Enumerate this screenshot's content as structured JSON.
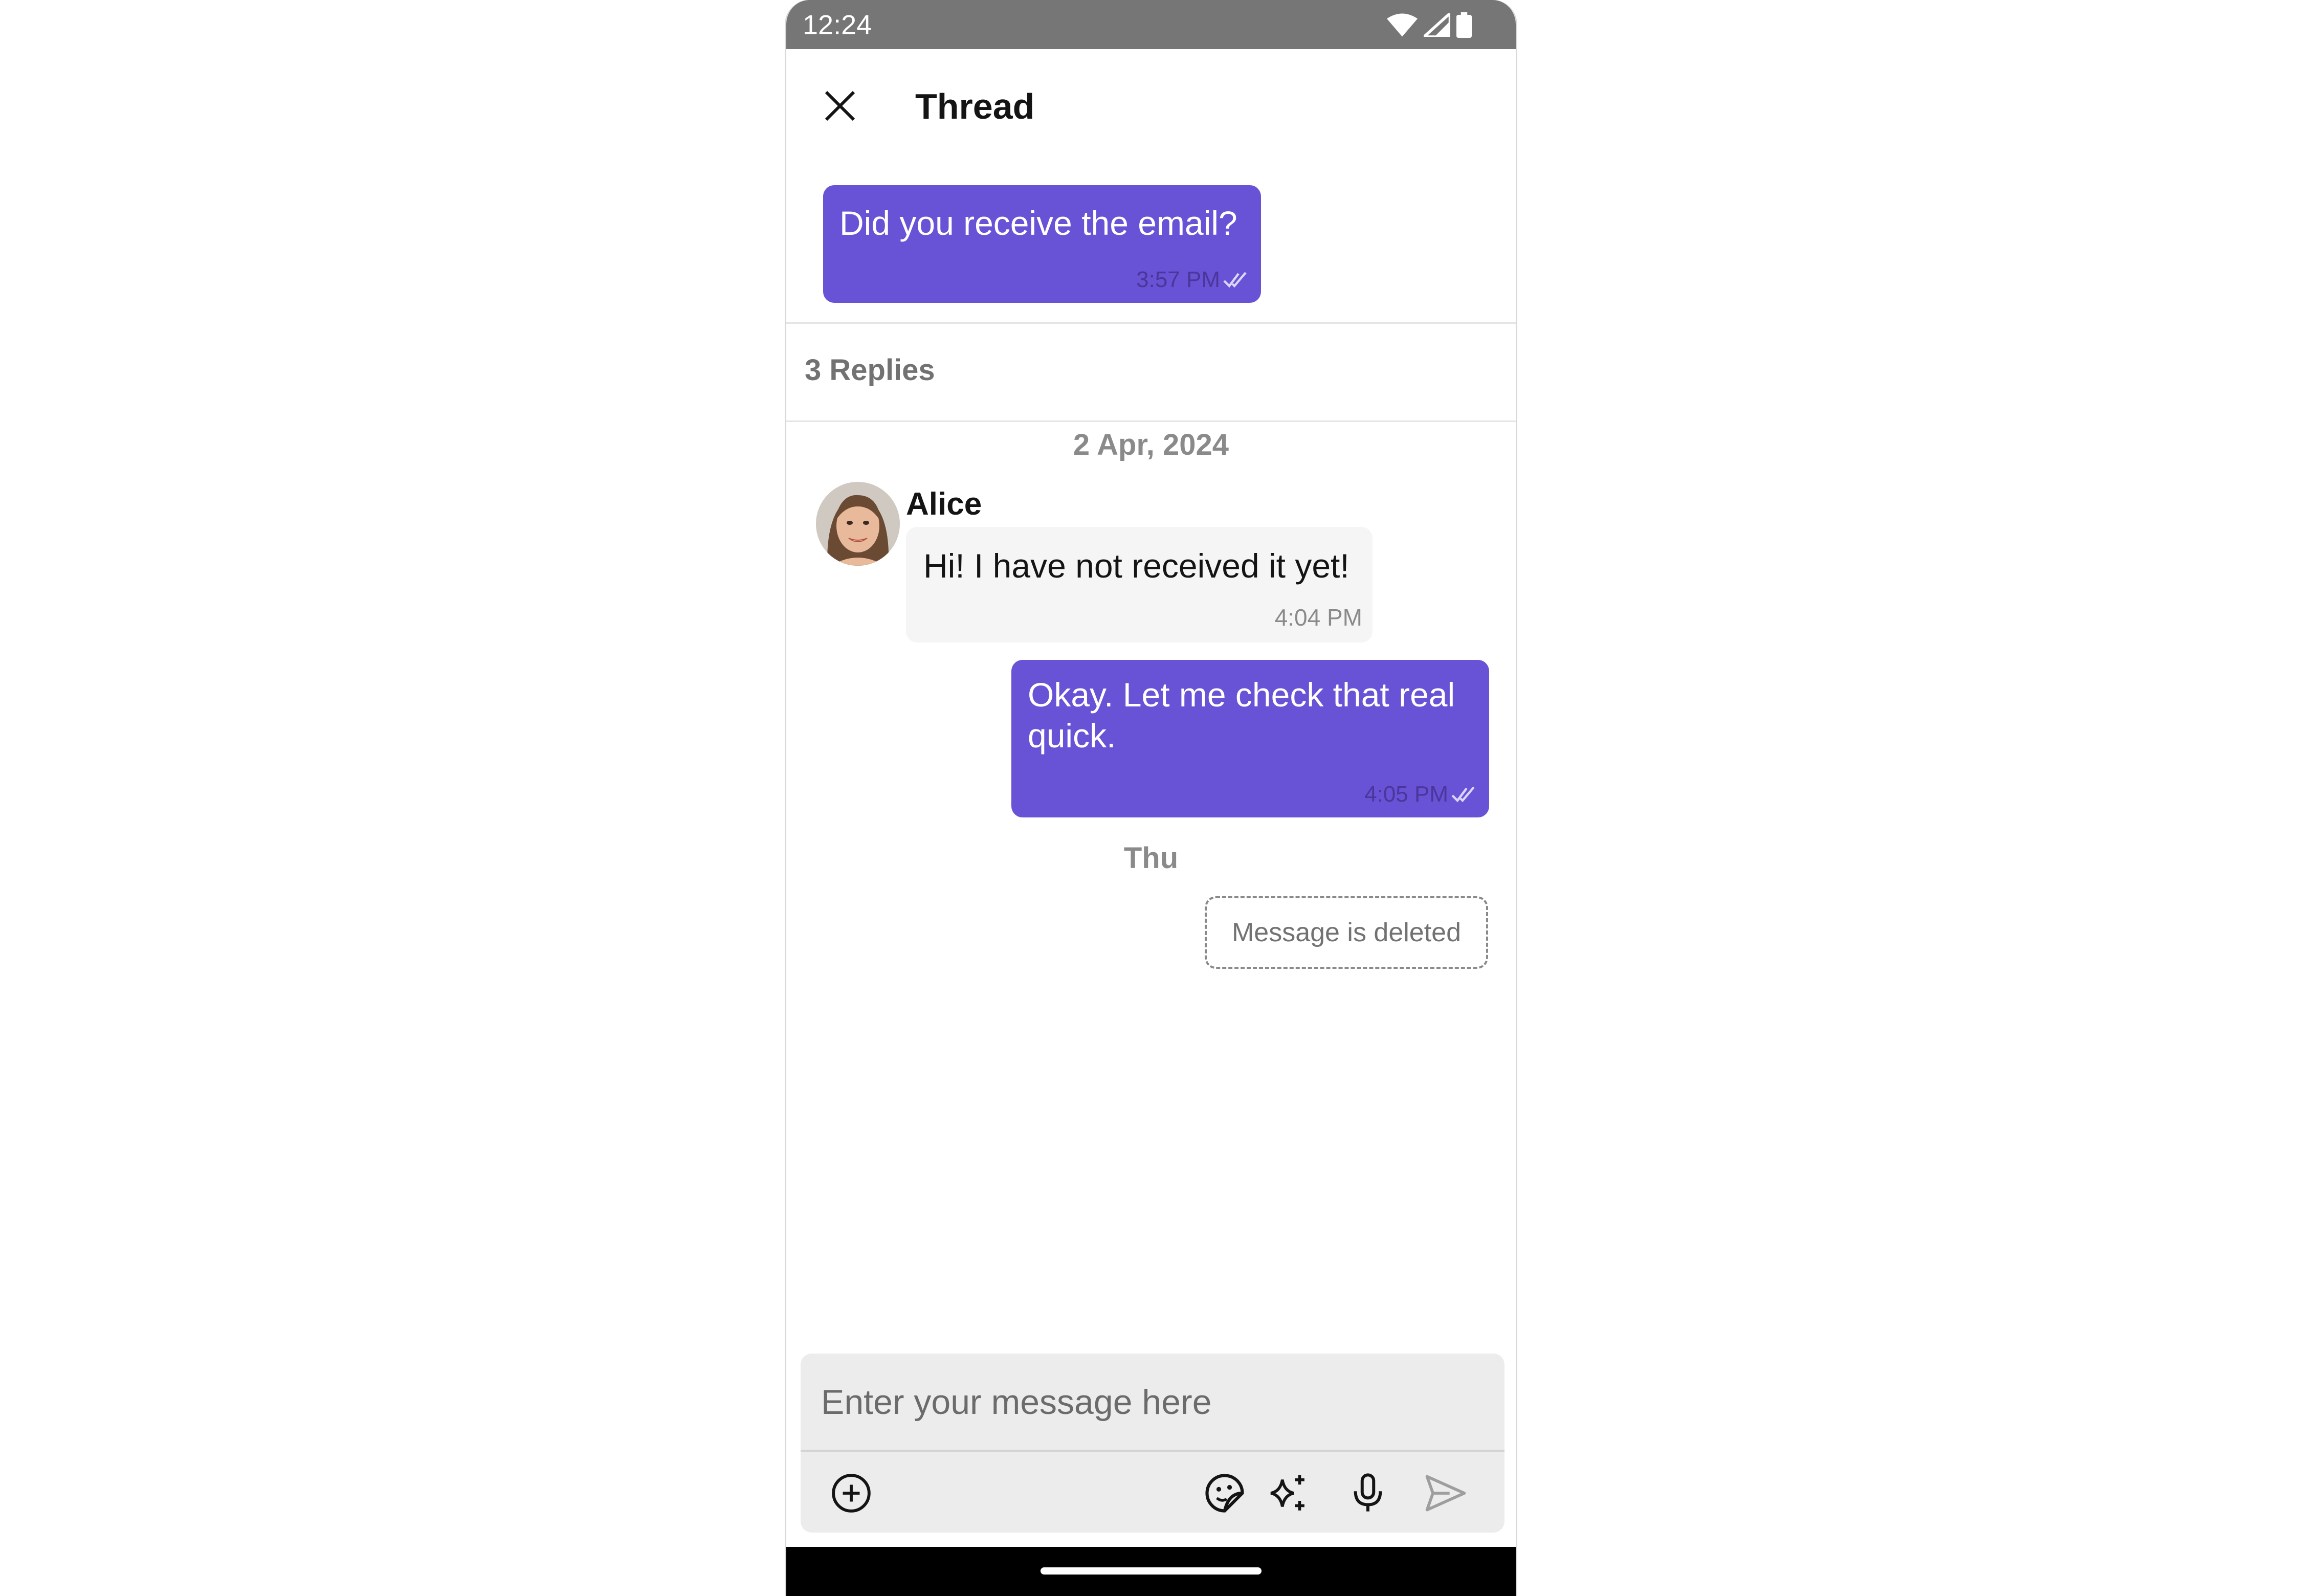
{
  "status_bar": {
    "time": "12:24"
  },
  "header": {
    "title": "Thread"
  },
  "parent_message": {
    "text": "Did you receive the email?",
    "time": "3:57 PM"
  },
  "thread": {
    "reply_count": "3 Replies",
    "date_1": "2 Apr, 2024",
    "date_2": "Thu",
    "messages": [
      {
        "sender": "Alice",
        "text": "Hi! I have not received it yet!",
        "time": "4:04 PM"
      },
      {
        "text": "Okay. Let me check that real quick.",
        "time": "4:05 PM"
      },
      {
        "text": "Message is deleted"
      }
    ]
  },
  "composer": {
    "placeholder": "Enter your message here"
  },
  "colors": {
    "accent": "#6852d6",
    "status_bar": "#767676",
    "incoming_bubble": "#f5f5f5"
  }
}
